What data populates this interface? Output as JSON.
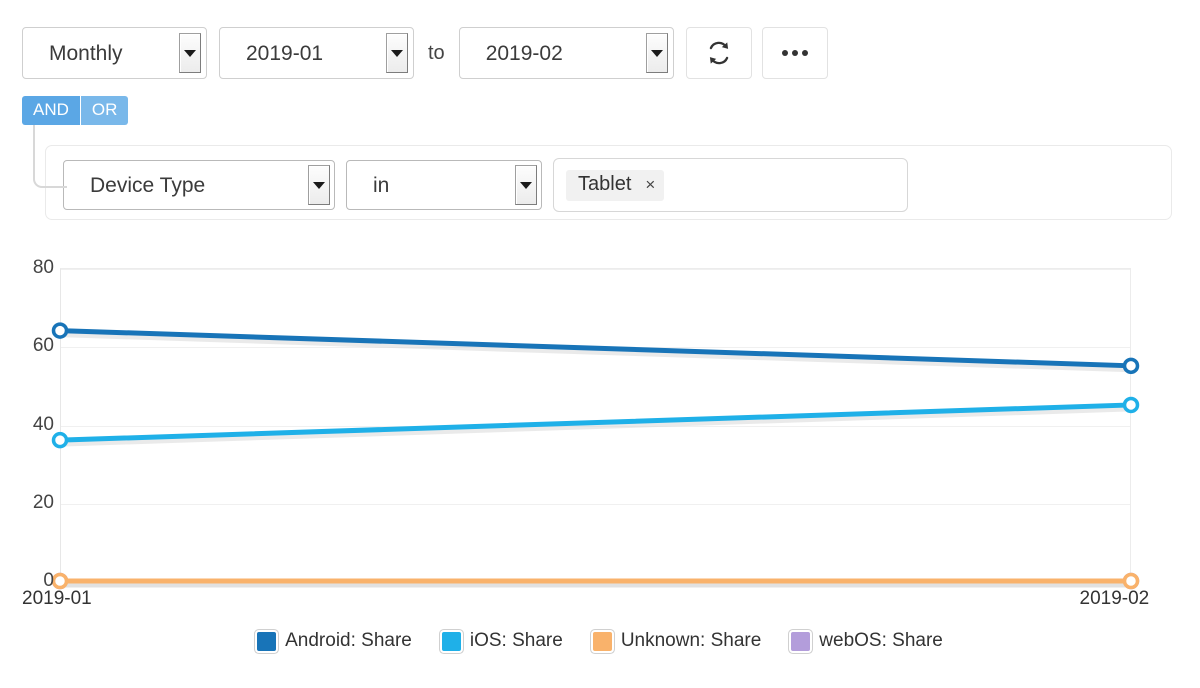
{
  "toolbar": {
    "period_select": {
      "value": "Monthly",
      "icon": "chevron-down-icon"
    },
    "from_select": {
      "value": "2019-01"
    },
    "to_word": "to",
    "to_select": {
      "value": "2019-02"
    },
    "refresh_button": {
      "icon": "refresh-icon",
      "label": ""
    },
    "more_button": {
      "icon": "ellipsis-icon",
      "label": ""
    }
  },
  "logic_toggle": {
    "and_label": "AND",
    "or_label": "OR",
    "active": "AND",
    "active_color": "#5ba7e5",
    "inactive_color": "#79b8ea"
  },
  "filter": {
    "field_select": {
      "value": "Device Type"
    },
    "operator_select": {
      "value": "in"
    },
    "values": [
      {
        "label": "Tablet",
        "remove_icon": "close-icon",
        "remove_label": "×"
      }
    ]
  },
  "chart_data": {
    "type": "line",
    "title": "",
    "xlabel": "",
    "ylabel": "",
    "categories": [
      "2019-01",
      "2019-02"
    ],
    "x_tick_labels": [
      "2019-01",
      "2019-02"
    ],
    "y_tick_labels": [
      "0",
      "20",
      "40",
      "60",
      "80"
    ],
    "y_ticks": [
      0,
      20,
      40,
      60,
      80
    ],
    "ylim": [
      0,
      80
    ],
    "grid": true,
    "legend_position": "bottom",
    "series": [
      {
        "name": "Android: Share",
        "color": "#1874b8",
        "values": [
          64,
          55
        ]
      },
      {
        "name": "iOS: Share",
        "color": "#1fb0e8",
        "values": [
          36,
          45
        ]
      },
      {
        "name": "Unknown: Share",
        "color": "#f9b26b",
        "values": [
          0,
          0
        ]
      },
      {
        "name": "webOS: Share",
        "color": "#b39ddb",
        "values": [
          0,
          0
        ]
      }
    ]
  }
}
